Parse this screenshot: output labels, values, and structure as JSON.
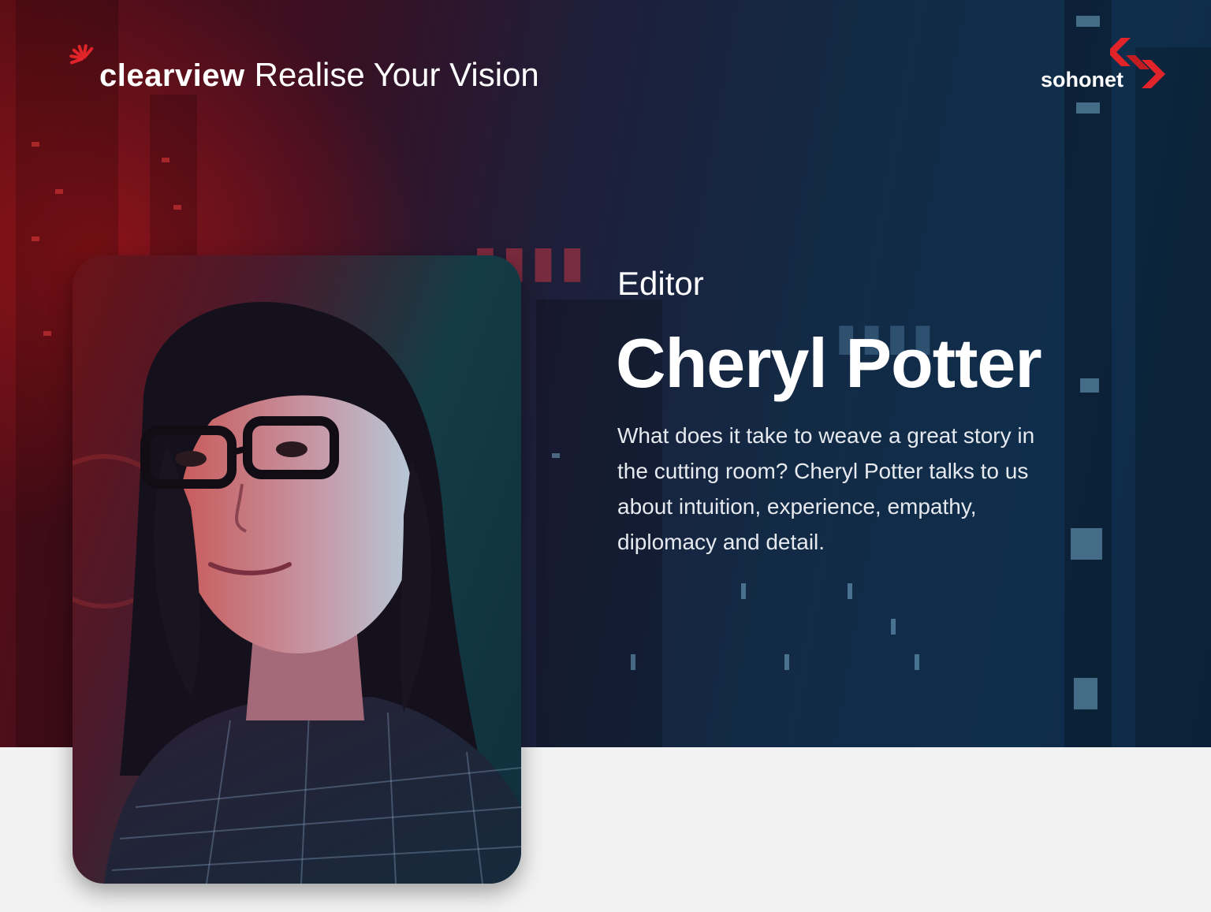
{
  "header": {
    "brand_name": "clearview",
    "brand_tagline": "Realise Your Vision",
    "partner_logo": "sohonet"
  },
  "profile": {
    "role": "Editor",
    "name": "Cheryl Potter",
    "description": "What does it take to weave a great story in the cutting room? Cheryl Potter talks to us about intuition, experience, empathy, diplomacy and detail.",
    "photo_alt": "Portrait of Cheryl Potter"
  },
  "colors": {
    "accent_red": "#e1242a",
    "hero_dark_red": "#5a0d14",
    "hero_blue": "#0f2e4c",
    "page_background": "#f2f2f2"
  },
  "icons": {
    "clearview_burst": "starburst-logo-icon",
    "sohonet_mark": "double-chevron-logo-icon"
  }
}
